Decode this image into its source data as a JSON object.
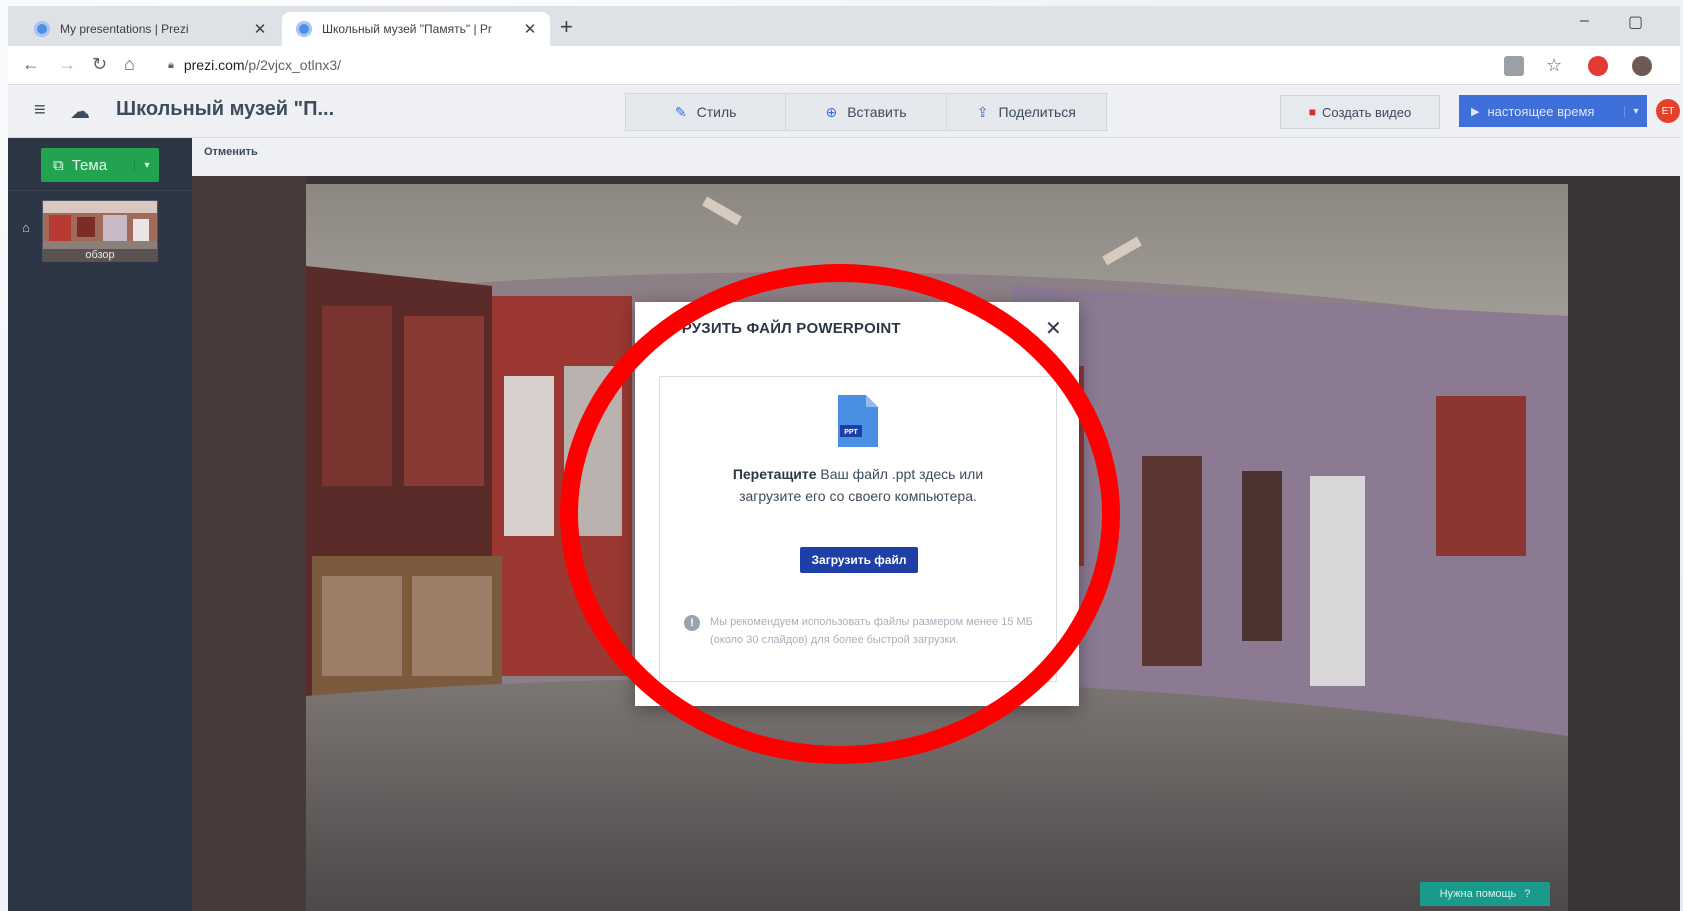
{
  "browser": {
    "tabs": [
      {
        "title": "My presentations | Prezi"
      },
      {
        "title": "Школьный музей \"Память\" | Pr"
      }
    ],
    "url_domain": "prezi.com",
    "url_path": "/p/2vjcx_otlnx3/"
  },
  "header": {
    "title": "Школьный музей \"П...",
    "tools": [
      {
        "label": "Стиль",
        "icon": "pen-icon"
      },
      {
        "label": "Вставить",
        "icon": "plus-circle-icon"
      },
      {
        "label": "Поделиться",
        "icon": "share-icon"
      }
    ],
    "create_video_label": "Создать видео",
    "live_label": "настоящее время",
    "avatar_initials": "ET"
  },
  "sidebar": {
    "theme_label": "Тема",
    "slides": [
      {
        "label": "обзор"
      }
    ]
  },
  "toolbar": {
    "cancel_label": "Отменить"
  },
  "modal": {
    "title": "ГРУЗИТЬ ФАЙЛ POWERPOINT",
    "file_badge": "PPT",
    "drag_bold": "Перетащите",
    "drag_text": " Ваш файл .ppt здесь или загрузите его со своего компьютера.",
    "upload_button": "Загрузить файл",
    "hint": "Мы рекомендуем использовать файлы размером менее 15 МБ (около 30 слайдов) для более быстрой загрузки."
  },
  "help_label": "Нужна помощь",
  "colors": {
    "annotation": "#ff0000",
    "upload_button": "#1e3fa6",
    "theme_button": "#22a34f",
    "live_button": "#3f6fd8"
  }
}
